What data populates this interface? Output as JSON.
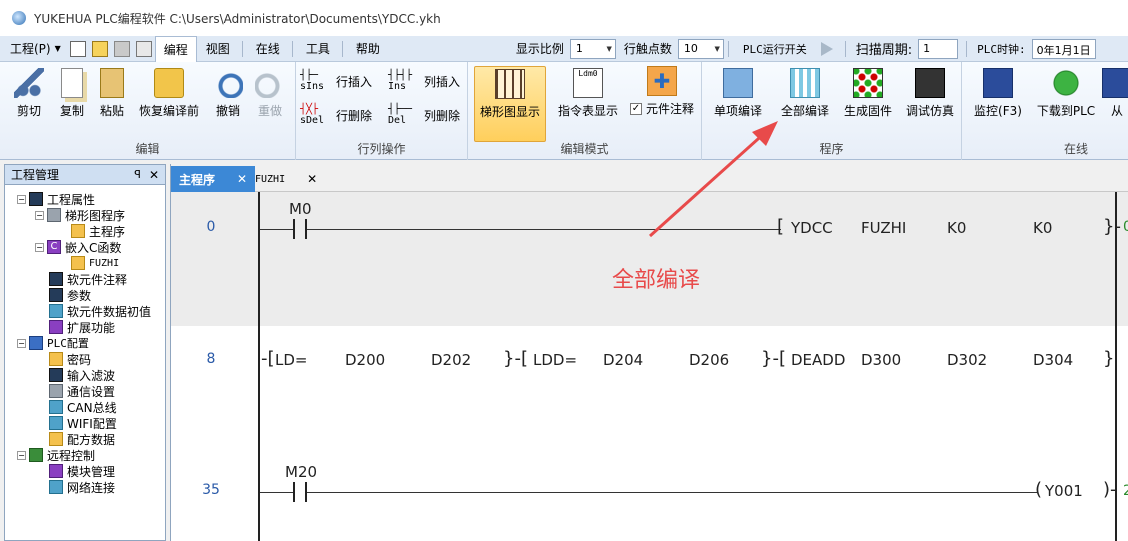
{
  "window": {
    "title": "YUKEHUA PLC编程软件 C:\\Users\\Administrator\\Documents\\YDCC.ykh"
  },
  "menubar": {
    "project_label": "工程(P)",
    "tabs": [
      "编程",
      "视图",
      "在线",
      "工具",
      "帮助"
    ],
    "active_tab": "编程",
    "zoom_label": "显示比例",
    "zoom_value": "1",
    "contacts_label": "行触点数",
    "contacts_value": "10",
    "run_switch_label": "PLC运行开关",
    "scan_period_label": "扫描周期:",
    "scan_period_value": "1",
    "clock_label": "PLC时钟:",
    "clock_value": "0年1月1日"
  },
  "ribbon": {
    "groups": {
      "edit": {
        "label": "编辑",
        "buttons": [
          "剪切",
          "复制",
          "粘贴",
          "恢复编译前",
          "撤销",
          "重做"
        ]
      },
      "rowcol": {
        "label": "行列操作",
        "buttons": [
          {
            "code": "sIns",
            "label": "行插入"
          },
          {
            "code": "sDel",
            "label": "行删除"
          },
          {
            "code": "Ins",
            "label": "列插入"
          },
          {
            "code": "Del",
            "label": "列删除"
          }
        ]
      },
      "mode": {
        "label": "编辑模式",
        "buttons": [
          "梯形图显示",
          "指令表显示"
        ],
        "list_icon_text": "Ldm0",
        "checkbox_label": "元件注释",
        "checkbox_checked": true
      },
      "program": {
        "label": "程序",
        "buttons": [
          "单项编译",
          "全部编译",
          "生成固件",
          "调试仿真"
        ]
      },
      "online": {
        "label": "在线",
        "buttons": [
          "监控(F3)",
          "下载到PLC",
          "从"
        ]
      }
    }
  },
  "left_panel": {
    "title": "工程管理",
    "pin": "ꟼ",
    "tree": [
      {
        "label": "工程属性",
        "level": 0,
        "toggle": "−"
      },
      {
        "label": "梯形图程序",
        "level": 1,
        "toggle": "−"
      },
      {
        "label": "主程序",
        "level": 2
      },
      {
        "label": "嵌入C函数",
        "level": 1,
        "toggle": "−"
      },
      {
        "label": "FUZHI",
        "level": 2
      },
      {
        "label": "软元件注释",
        "level": 1
      },
      {
        "label": "参数",
        "level": 1
      },
      {
        "label": "软元件数据初值",
        "level": 1
      },
      {
        "label": "扩展功能",
        "level": 1
      },
      {
        "label": "PLC配置",
        "level": 0,
        "toggle": "−"
      },
      {
        "label": "密码",
        "level": 1
      },
      {
        "label": "输入滤波",
        "level": 1
      },
      {
        "label": "通信设置",
        "level": 1
      },
      {
        "label": "CAN总线",
        "level": 1
      },
      {
        "label": "WIFI配置",
        "level": 1
      },
      {
        "label": "配方数据",
        "level": 1
      },
      {
        "label": "远程控制",
        "level": 0,
        "toggle": "−"
      },
      {
        "label": "模块管理",
        "level": 1
      },
      {
        "label": "网络连接",
        "level": 1
      }
    ]
  },
  "editor": {
    "tabs": [
      {
        "label": "主程序",
        "active": true
      },
      {
        "label": "FUZHI",
        "active": false
      }
    ],
    "rungs": [
      {
        "step": "0",
        "contact": "M0",
        "instruction": [
          "YDCC",
          "FUZHI",
          "K0",
          "K0"
        ],
        "selected": true
      },
      {
        "step": "8",
        "blocks": [
          [
            "LD=",
            "D200",
            "D202"
          ],
          [
            "LDD=",
            "D204",
            "D206"
          ],
          [
            "DEADD",
            "D300",
            "D302",
            "D304"
          ]
        ]
      },
      {
        "step": "35",
        "contact": "M20",
        "coil": "Y001"
      }
    ]
  },
  "annotation": {
    "text": "全部编译",
    "color": "#e84a4a"
  }
}
